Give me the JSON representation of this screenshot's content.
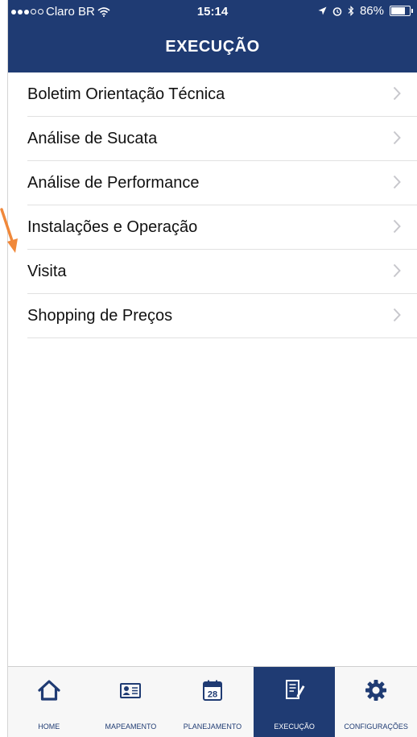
{
  "status": {
    "carrier": "Claro BR",
    "time": "15:14",
    "battery_pct": "86%",
    "battery_level": 0.86
  },
  "nav": {
    "title": "EXECUÇÃO"
  },
  "menu": [
    {
      "label": "Boletim Orientação Técnica"
    },
    {
      "label": "Análise de Sucata"
    },
    {
      "label": "Análise de Performance"
    },
    {
      "label": "Instalações e Operação"
    },
    {
      "label": "Visita"
    },
    {
      "label": "Shopping de Preços"
    }
  ],
  "tabs": [
    {
      "label": "HOME",
      "icon": "home-icon"
    },
    {
      "label": "MAPEAMENTO",
      "icon": "id-card-icon"
    },
    {
      "label": "PLANEJAMENTO",
      "icon": "calendar-icon",
      "day": "28"
    },
    {
      "label": "EXECUÇÃO",
      "icon": "edit-document-icon",
      "active": true
    },
    {
      "label": "CONFIGURAÇÕES",
      "icon": "gear-icon"
    }
  ],
  "colors": {
    "brand": "#1f3b73",
    "arrow": "#f0883a",
    "chevron": "#c7c7cc",
    "separator": "#e1e1e1"
  }
}
